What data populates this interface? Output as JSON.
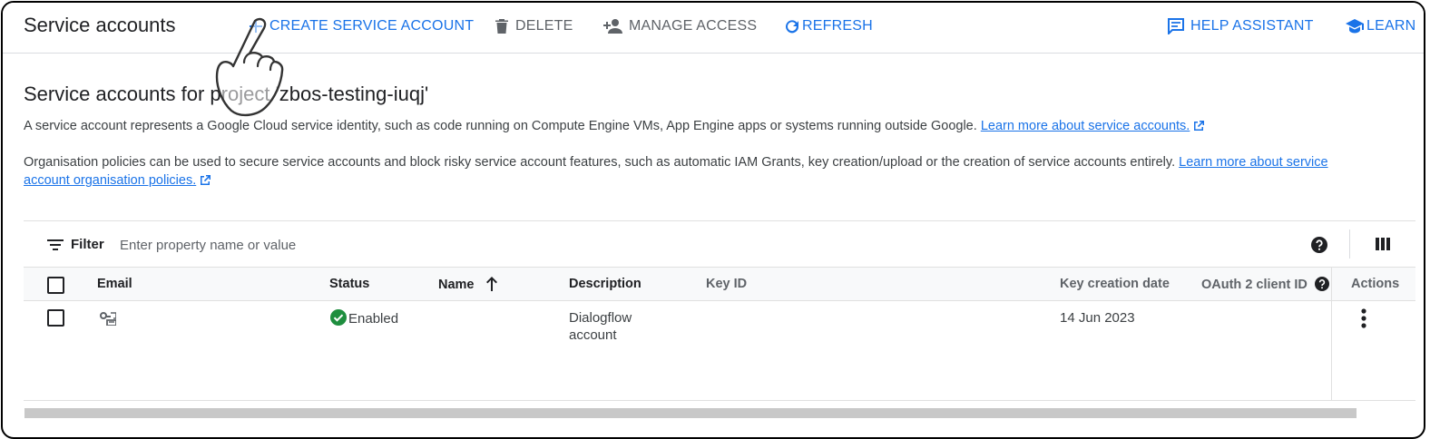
{
  "header": {
    "title": "Service accounts",
    "create_label": "CREATE SERVICE ACCOUNT",
    "delete_label": "DELETE",
    "manage_access_label": "MANAGE ACCESS",
    "refresh_label": "REFRESH",
    "help_assistant_label": "HELP ASSISTANT",
    "learn_label": "LEARN"
  },
  "content": {
    "heading": "Service accounts for project 'zbos-testing-iuqj'",
    "para1_text": "A service account represents a Google Cloud service identity, such as code running on Compute Engine VMs, App Engine apps or systems running outside Google.",
    "para1_link": "Learn more about service accounts.",
    "para2_text": "Organisation policies can be used to secure service accounts and block risky service account features, such as automatic IAM Grants, key creation/upload or the creation of service accounts entirely.",
    "para2_link_line1": "Learn more about service",
    "para2_link_line2": "account organisation policies."
  },
  "filter": {
    "label": "Filter",
    "placeholder": "Enter property name or value"
  },
  "table": {
    "columns": {
      "email": "Email",
      "status": "Status",
      "name": "Name",
      "description": "Description",
      "key_id": "Key ID",
      "key_creation_date": "Key creation date",
      "oauth_client_id": "OAuth 2 client ID",
      "actions": "Actions"
    },
    "rows": [
      {
        "status": "Enabled",
        "description_line1": "Dialogflow",
        "description_line2": "account",
        "key_creation_date": "14 Jun 2023"
      }
    ]
  },
  "colors": {
    "accent": "#1a73e8",
    "status_enabled": "#1e8e3e",
    "muted": "#5f6368"
  }
}
